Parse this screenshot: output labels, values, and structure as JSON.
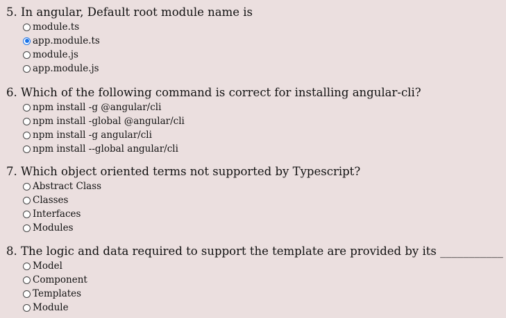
{
  "questions": [
    {
      "text": "5. In angular, Default root module name is",
      "options": [
        {
          "label": "module.ts",
          "checked": false
        },
        {
          "label": "app.module.ts",
          "checked": true
        },
        {
          "label": "module.js",
          "checked": false
        },
        {
          "label": "app.module.js",
          "checked": false
        }
      ]
    },
    {
      "text": "6. Which of the following command is correct for installing angular-cli?",
      "options": [
        {
          "label": "npm install -g @angular/cli",
          "checked": false
        },
        {
          "label": "npm install -global @angular/cli",
          "checked": false
        },
        {
          "label": "npm install -g angular/cli",
          "checked": false
        },
        {
          "label": "npm install --global angular/cli",
          "checked": false
        }
      ]
    },
    {
      "text": "7. Which object oriented terms not supported by Typescript?",
      "options": [
        {
          "label": "Abstract Class",
          "checked": false
        },
        {
          "label": "Classes",
          "checked": false
        },
        {
          "label": "Interfaces",
          "checked": false
        },
        {
          "label": "Modules",
          "checked": false
        }
      ]
    },
    {
      "text": "8. The logic and data required to support the template are provided by its ___________",
      "options": [
        {
          "label": "Model",
          "checked": false
        },
        {
          "label": "Component",
          "checked": false
        },
        {
          "label": "Templates",
          "checked": false
        },
        {
          "label": "Module",
          "checked": false
        }
      ]
    }
  ]
}
